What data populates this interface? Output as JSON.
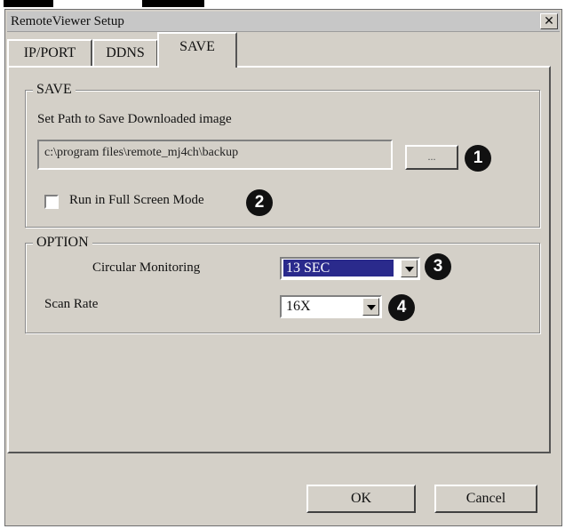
{
  "window": {
    "title": "RemoteViewer Setup",
    "close_glyph": "✕"
  },
  "tabs": [
    {
      "label": "IP/PORT",
      "active": false
    },
    {
      "label": "DDNS",
      "active": false
    },
    {
      "label": "SAVE",
      "active": true
    }
  ],
  "save_group": {
    "legend": "SAVE",
    "path_label": "Set Path to Save Downloaded image",
    "path_value": "c:\\program files\\remote_mj4ch\\backup",
    "browse_label": "...",
    "fullscreen_label": "Run in Full Screen Mode",
    "fullscreen_checked": false
  },
  "option_group": {
    "legend": "OPTION",
    "circular_label": "Circular Monitoring",
    "circular_value": "13 SEC",
    "scan_label": "Scan Rate",
    "scan_value": "16X"
  },
  "buttons": {
    "ok": "OK",
    "cancel": "Cancel"
  },
  "callouts": [
    "1",
    "2",
    "3",
    "4"
  ],
  "colors": {
    "selection": "#2a2a8c",
    "dialog_bg": "#d4d0c8",
    "badge": "#111111"
  }
}
